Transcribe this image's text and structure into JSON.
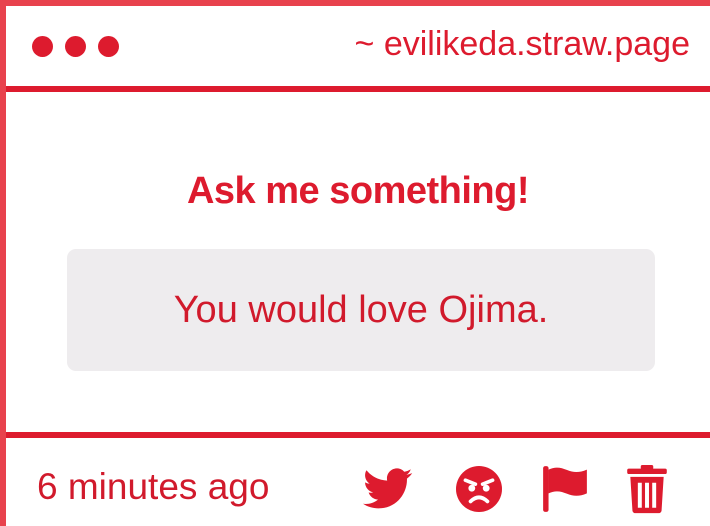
{
  "titlebar": {
    "url_text": "~ evilikeda.straw.page"
  },
  "main": {
    "heading": "Ask me something!",
    "question": "You would love Ojima."
  },
  "footer": {
    "timestamp": "6 minutes ago",
    "actions": [
      "twitter-icon",
      "angry-face-icon",
      "flag-icon",
      "trash-icon"
    ]
  },
  "colors": {
    "accent": "#dd1b2e",
    "border": "#e8424d",
    "question_bg": "#eeecee",
    "text": "#d11a2c"
  }
}
